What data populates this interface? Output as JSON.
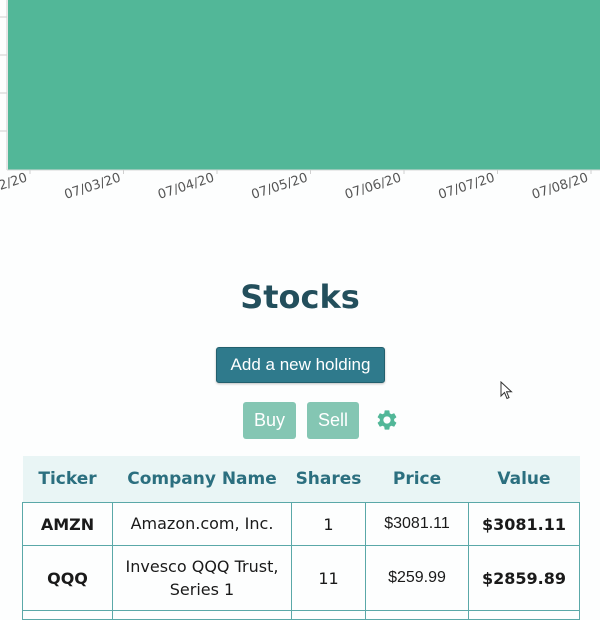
{
  "chart": {
    "fill_color": "#52b798",
    "x_tick_labels": [
      "/2/20",
      "07/03/20",
      "07/04/20",
      "07/05/20",
      "07/06/20",
      "07/07/20",
      "07/08/20"
    ]
  },
  "stocks": {
    "title": "Stocks",
    "add_button_label": "Add a new holding",
    "buy_label": "Buy",
    "sell_label": "Sell",
    "table": {
      "headers": [
        "Ticker",
        "Company Name",
        "Shares",
        "Price",
        "Value"
      ],
      "rows": [
        {
          "ticker": "AMZN",
          "company": "Amazon.com, Inc.",
          "shares": "1",
          "price": "$3081.11",
          "value": "$3081.11"
        },
        {
          "ticker": "QQQ",
          "company_line1": "Invesco QQQ Trust,",
          "company_line2": "Series 1",
          "shares": "11",
          "price": "$259.99",
          "value": "$2859.89"
        }
      ]
    }
  },
  "colors": {
    "accent": "#52b798",
    "primary_button": "#2f7a8c",
    "title": "#234f5c",
    "value_text": "#4aa98a"
  }
}
